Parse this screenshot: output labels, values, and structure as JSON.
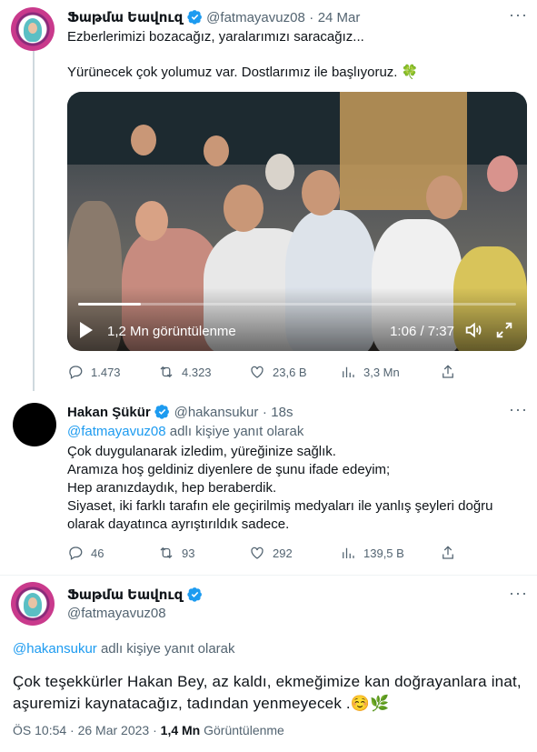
{
  "tweet1": {
    "display_name": "Ֆաթմա Եավուզ",
    "handle": "@fatmayavuz08",
    "separator": "·",
    "date": "24 Mar",
    "line1": "Ezberlerimizi bozacağız, yaralarımızı saracağız...",
    "line2": "Yürünecek çok yolumuz var. Dostlarımız ile başlıyoruz. 🍀",
    "video": {
      "views": "1,2 Mn görüntülenme",
      "time": "1:06 / 7:37",
      "progress_fraction": 0.144
    },
    "actions": {
      "replies": "1.473",
      "retweets": "4.323",
      "likes": "23,6 B",
      "views": "3,3 Mn"
    }
  },
  "tweet2": {
    "display_name": "Hakan Şükür",
    "handle": "@hakansukur",
    "separator": "·",
    "date": "18s",
    "reply_to_handle": "@fatmayavuz08",
    "reply_to_suffix": "adlı kişiye yanıt olarak",
    "lines": [
      "Çok duygulanarak izledim, yüreğinize sağlık.",
      "Aramıza hoş geldiniz diyenlere de şunu ifade edeyim;",
      "Hep aranızdaydık, hep beraberdik.",
      "Siyaset, iki farklı tarafın ele geçirilmiş medyaları ile yanlış şeyleri doğru",
      "olarak dayatınca ayrıştırıldık sadece."
    ],
    "actions": {
      "replies": "46",
      "retweets": "93",
      "likes": "292",
      "views": "139,5 B"
    }
  },
  "tweet3": {
    "display_name": "Ֆաթմա Եավուզ",
    "handle": "@fatmayavuz08",
    "reply_to_handle": "@hakansukur",
    "reply_to_suffix": "adlı kişiye yanıt olarak",
    "line1": "Çok teşekkürler Hakan Bey, az kaldı, ekmeğimize kan doğrayanlara inat,",
    "line2": "aşuremizi kaynatacağız, tadından yenmeyecek .☺️🌿",
    "meta_time": "ÖS 10:54 · 26 Mar 2023 ·",
    "meta_views_count": "1,4 Mn",
    "meta_views_label": "Görüntülenme"
  },
  "more_label": "···",
  "colors": {
    "accent": "#1d9bf0",
    "muted": "#536471",
    "text": "#0f1419"
  },
  "icons": [
    "verified-badge-icon",
    "more-icon",
    "reply-icon",
    "retweet-icon",
    "like-icon",
    "views-icon",
    "share-icon",
    "play-icon",
    "volume-icon",
    "fullscreen-icon"
  ]
}
